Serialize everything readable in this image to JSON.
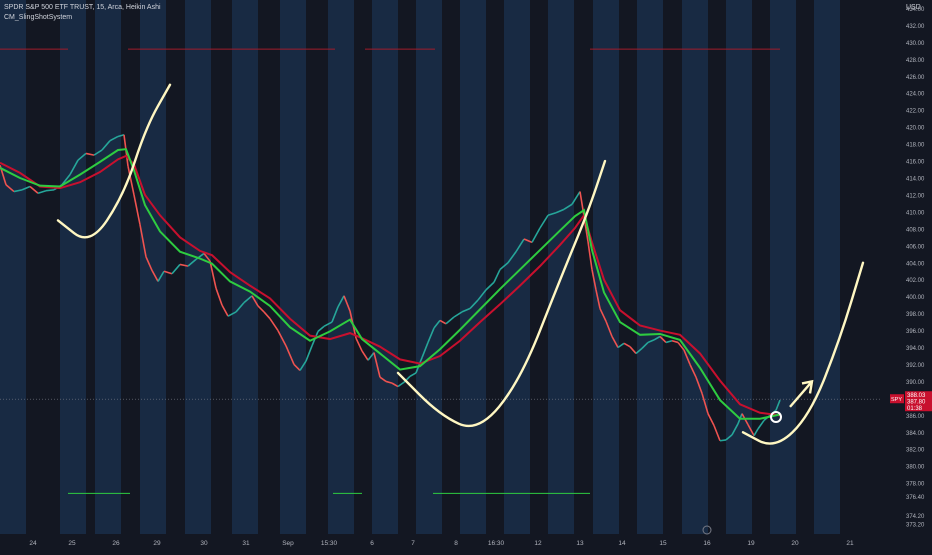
{
  "legend": {
    "title": "SPDR S&P 500 ETF TRUST, 15, Arca, Heikin Ashi",
    "indicator": "CM_SlingShotSystem"
  },
  "axis": {
    "unit": "USD",
    "price_ticks": [
      "434.00",
      "432.00",
      "430.00",
      "428.00",
      "426.00",
      "424.00",
      "422.00",
      "420.00",
      "418.00",
      "416.00",
      "414.00",
      "412.00",
      "410.00",
      "408.00",
      "406.00",
      "404.00",
      "402.00",
      "400.00",
      "398.00",
      "396.00",
      "394.00",
      "392.00",
      "390.00",
      "388.00",
      "386.00",
      "384.00",
      "382.00",
      "380.00",
      "378.00",
      "376.40",
      "374.20",
      "373.20"
    ],
    "time_ticks": [
      "24",
      "25",
      "26",
      "29",
      "30",
      "31",
      "Sep",
      "15:30",
      "6",
      "7",
      "8",
      "16:30",
      "12",
      "13",
      "14",
      "15",
      "16",
      "19",
      "20",
      "21"
    ]
  },
  "price_label": {
    "symbol": "SPY",
    "price": "387.80",
    "countdown": "01:38",
    "upper": "388.03"
  },
  "colors": {
    "background": "#131722",
    "session_band": "#1e3a5f",
    "candle_up": "#26a69a",
    "candle_down": "#ef5350",
    "ema_slow_red": "#c8102e",
    "ema_fast_green": "#2ecc40",
    "drawing": "#fff7c2",
    "resistance": "#a01c2b",
    "support": "#2ecc40"
  },
  "chart_data": {
    "type": "line",
    "title": "SPDR S&P 500 ETF TRUST, 15, Arca, Heikin Ashi",
    "ylabel": "USD",
    "ylim": [
      372,
      435
    ],
    "x_tick_labels": [
      "24",
      "25",
      "26",
      "29",
      "30",
      "31",
      "Sep",
      "15:30",
      "6",
      "7",
      "8",
      "16:30",
      "12",
      "13",
      "14",
      "15",
      "16",
      "19",
      "20",
      "21"
    ],
    "series": [
      {
        "name": "price",
        "values": [
          [
            0,
            415.5
          ],
          [
            6,
            413.2
          ],
          [
            14,
            412.4
          ],
          [
            22,
            412.6
          ],
          [
            30,
            413.0
          ],
          [
            38,
            412.2
          ],
          [
            46,
            412.5
          ],
          [
            54,
            412.6
          ],
          [
            62,
            413.2
          ],
          [
            70,
            414.4
          ],
          [
            78,
            416.1
          ],
          [
            86,
            416.9
          ],
          [
            94,
            416.7
          ],
          [
            102,
            417.3
          ],
          [
            110,
            418.4
          ],
          [
            118,
            418.9
          ],
          [
            124,
            419.1
          ],
          [
            128,
            415.4
          ],
          [
            134,
            412.0
          ],
          [
            140,
            408.5
          ],
          [
            146,
            404.7
          ],
          [
            152,
            403.1
          ],
          [
            158,
            401.8
          ],
          [
            164,
            403.0
          ],
          [
            172,
            402.7
          ],
          [
            180,
            403.8
          ],
          [
            188,
            403.6
          ],
          [
            196,
            404.4
          ],
          [
            204,
            405.1
          ],
          [
            210,
            404.2
          ],
          [
            216,
            401.0
          ],
          [
            222,
            399.0
          ],
          [
            228,
            397.7
          ],
          [
            236,
            398.2
          ],
          [
            244,
            399.3
          ],
          [
            252,
            400.1
          ],
          [
            258,
            398.9
          ],
          [
            264,
            398.2
          ],
          [
            270,
            397.4
          ],
          [
            278,
            396.0
          ],
          [
            286,
            394.2
          ],
          [
            294,
            392.0
          ],
          [
            300,
            391.3
          ],
          [
            306,
            392.4
          ],
          [
            312,
            394.2
          ],
          [
            318,
            395.9
          ],
          [
            324,
            396.5
          ],
          [
            332,
            397.0
          ],
          [
            338,
            398.8
          ],
          [
            344,
            400.1
          ],
          [
            350,
            398.3
          ],
          [
            356,
            395.1
          ],
          [
            362,
            393.6
          ],
          [
            368,
            392.5
          ],
          [
            374,
            393.4
          ],
          [
            380,
            390.5
          ],
          [
            386,
            390.0
          ],
          [
            392,
            389.8
          ],
          [
            398,
            389.4
          ],
          [
            404,
            389.9
          ],
          [
            410,
            390.6
          ],
          [
            416,
            391.0
          ],
          [
            422,
            392.8
          ],
          [
            428,
            394.6
          ],
          [
            434,
            396.3
          ],
          [
            440,
            397.2
          ],
          [
            446,
            396.8
          ],
          [
            454,
            397.6
          ],
          [
            462,
            398.2
          ],
          [
            470,
            398.6
          ],
          [
            478,
            399.6
          ],
          [
            486,
            400.8
          ],
          [
            494,
            401.7
          ],
          [
            500,
            403.2
          ],
          [
            508,
            404.0
          ],
          [
            516,
            405.3
          ],
          [
            524,
            406.8
          ],
          [
            532,
            406.4
          ],
          [
            540,
            408.1
          ],
          [
            548,
            409.6
          ],
          [
            556,
            409.9
          ],
          [
            564,
            410.3
          ],
          [
            572,
            410.9
          ],
          [
            580,
            412.4
          ],
          [
            584,
            409.5
          ],
          [
            588,
            406.5
          ],
          [
            592,
            403.2
          ],
          [
            596,
            400.8
          ],
          [
            600,
            398.6
          ],
          [
            606,
            397.1
          ],
          [
            612,
            395.3
          ],
          [
            618,
            394.0
          ],
          [
            624,
            394.5
          ],
          [
            630,
            394.1
          ],
          [
            636,
            393.3
          ],
          [
            642,
            393.9
          ],
          [
            648,
            394.6
          ],
          [
            654,
            394.9
          ],
          [
            660,
            395.3
          ],
          [
            666,
            394.6
          ],
          [
            672,
            394.8
          ],
          [
            678,
            394.6
          ],
          [
            684,
            393.7
          ],
          [
            690,
            392.0
          ],
          [
            696,
            390.5
          ],
          [
            702,
            388.6
          ],
          [
            708,
            386.2
          ],
          [
            714,
            384.8
          ],
          [
            720,
            383.0
          ],
          [
            726,
            383.1
          ],
          [
            732,
            383.7
          ],
          [
            738,
            385.0
          ],
          [
            742,
            386.2
          ],
          [
            748,
            384.9
          ],
          [
            754,
            383.6
          ],
          [
            758,
            384.4
          ],
          [
            764,
            385.4
          ],
          [
            770,
            386.0
          ],
          [
            776,
            386.6
          ],
          [
            780,
            387.8
          ]
        ]
      },
      {
        "name": "",
        "values": [
          [
            0,
            415.8
          ],
          [
            20,
            414.6
          ],
          [
            40,
            413.0
          ],
          [
            60,
            412.8
          ],
          [
            80,
            413.5
          ],
          [
            100,
            414.7
          ],
          [
            118,
            416.2
          ],
          [
            126,
            416.6
          ],
          [
            134,
            415.6
          ],
          [
            145,
            412.0
          ],
          [
            160,
            409.6
          ],
          [
            180,
            407.0
          ],
          [
            200,
            405.4
          ],
          [
            212,
            404.9
          ],
          [
            230,
            402.9
          ],
          [
            250,
            401.3
          ],
          [
            270,
            399.8
          ],
          [
            290,
            397.4
          ],
          [
            310,
            395.4
          ],
          [
            330,
            395.0
          ],
          [
            350,
            395.7
          ],
          [
            362,
            395.1
          ],
          [
            380,
            394.1
          ],
          [
            400,
            392.6
          ],
          [
            420,
            392.1
          ],
          [
            440,
            393.0
          ],
          [
            460,
            394.8
          ],
          [
            480,
            397.0
          ],
          [
            500,
            399.1
          ],
          [
            520,
            401.3
          ],
          [
            540,
            403.6
          ],
          [
            560,
            406.1
          ],
          [
            575,
            408.1
          ],
          [
            584,
            409.6
          ],
          [
            592,
            406.4
          ],
          [
            604,
            402.0
          ],
          [
            620,
            398.4
          ],
          [
            640,
            396.6
          ],
          [
            660,
            396.0
          ],
          [
            680,
            395.5
          ],
          [
            700,
            393.3
          ],
          [
            720,
            390.1
          ],
          [
            740,
            387.3
          ],
          [
            760,
            386.3
          ],
          [
            780,
            386.0
          ]
        ]
      },
      {
        "name": "",
        "values": [
          [
            0,
            415.2
          ],
          [
            20,
            414.0
          ],
          [
            40,
            413.1
          ],
          [
            60,
            413.0
          ],
          [
            80,
            414.4
          ],
          [
            100,
            415.9
          ],
          [
            118,
            417.3
          ],
          [
            126,
            417.4
          ],
          [
            134,
            414.9
          ],
          [
            145,
            410.8
          ],
          [
            160,
            407.7
          ],
          [
            180,
            405.3
          ],
          [
            200,
            404.5
          ],
          [
            212,
            403.9
          ],
          [
            230,
            401.8
          ],
          [
            250,
            400.6
          ],
          [
            270,
            398.9
          ],
          [
            290,
            396.4
          ],
          [
            310,
            394.8
          ],
          [
            330,
            395.9
          ],
          [
            350,
            397.3
          ],
          [
            362,
            395.0
          ],
          [
            380,
            393.3
          ],
          [
            400,
            391.4
          ],
          [
            420,
            391.8
          ],
          [
            440,
            393.8
          ],
          [
            460,
            396.1
          ],
          [
            480,
            398.5
          ],
          [
            500,
            400.9
          ],
          [
            520,
            403.2
          ],
          [
            540,
            405.5
          ],
          [
            560,
            407.8
          ],
          [
            575,
            409.5
          ],
          [
            584,
            410.2
          ],
          [
            592,
            405.5
          ],
          [
            604,
            400.5
          ],
          [
            620,
            397.0
          ],
          [
            640,
            395.5
          ],
          [
            660,
            395.6
          ],
          [
            680,
            394.9
          ],
          [
            700,
            391.6
          ],
          [
            720,
            387.8
          ],
          [
            740,
            385.6
          ],
          [
            760,
            385.6
          ],
          [
            780,
            386.1
          ]
        ]
      }
    ],
    "sessions_x_start": [
      0,
      60,
      95,
      140,
      185,
      232,
      280,
      328,
      372,
      416,
      460,
      504,
      548,
      593,
      637,
      682,
      726,
      770,
      814
    ],
    "resistance_lines": [
      {
        "x0": 0,
        "x1": 68,
        "y": 429.2
      },
      {
        "x0": 128,
        "x1": 335,
        "y": 429.2
      },
      {
        "x0": 365,
        "x1": 435,
        "y": 429.2
      },
      {
        "x0": 590,
        "x1": 780,
        "y": 429.2
      }
    ],
    "support_lines": [
      {
        "x0": 68,
        "x1": 130,
        "y": 376.8
      },
      {
        "x0": 333,
        "x1": 362,
        "y": 376.8
      },
      {
        "x0": 433,
        "x1": 590,
        "y": 376.8
      }
    ],
    "price_line": 387.9,
    "drawings": [
      {
        "kind": "curve",
        "points": [
          [
            58,
            409
          ],
          [
            90,
            406
          ],
          [
            124,
            412
          ],
          [
            146,
            420
          ],
          [
            170,
            425
          ]
        ]
      },
      {
        "kind": "curve",
        "points": [
          [
            398,
            391
          ],
          [
            440,
            386
          ],
          [
            478,
            384
          ],
          [
            520,
            390
          ],
          [
            560,
            402
          ],
          [
            588,
            410
          ],
          [
            605,
            416
          ]
        ]
      },
      {
        "kind": "curve",
        "points": [
          [
            743,
            384
          ],
          [
            775,
            382
          ],
          [
            810,
            386
          ],
          [
            840,
            395
          ],
          [
            863,
            404
          ]
        ]
      },
      {
        "kind": "arrow",
        "points": [
          [
            790,
            387
          ],
          [
            812,
            390
          ]
        ]
      },
      {
        "kind": "circle",
        "center": [
          776,
          385.8
        ]
      }
    ]
  }
}
